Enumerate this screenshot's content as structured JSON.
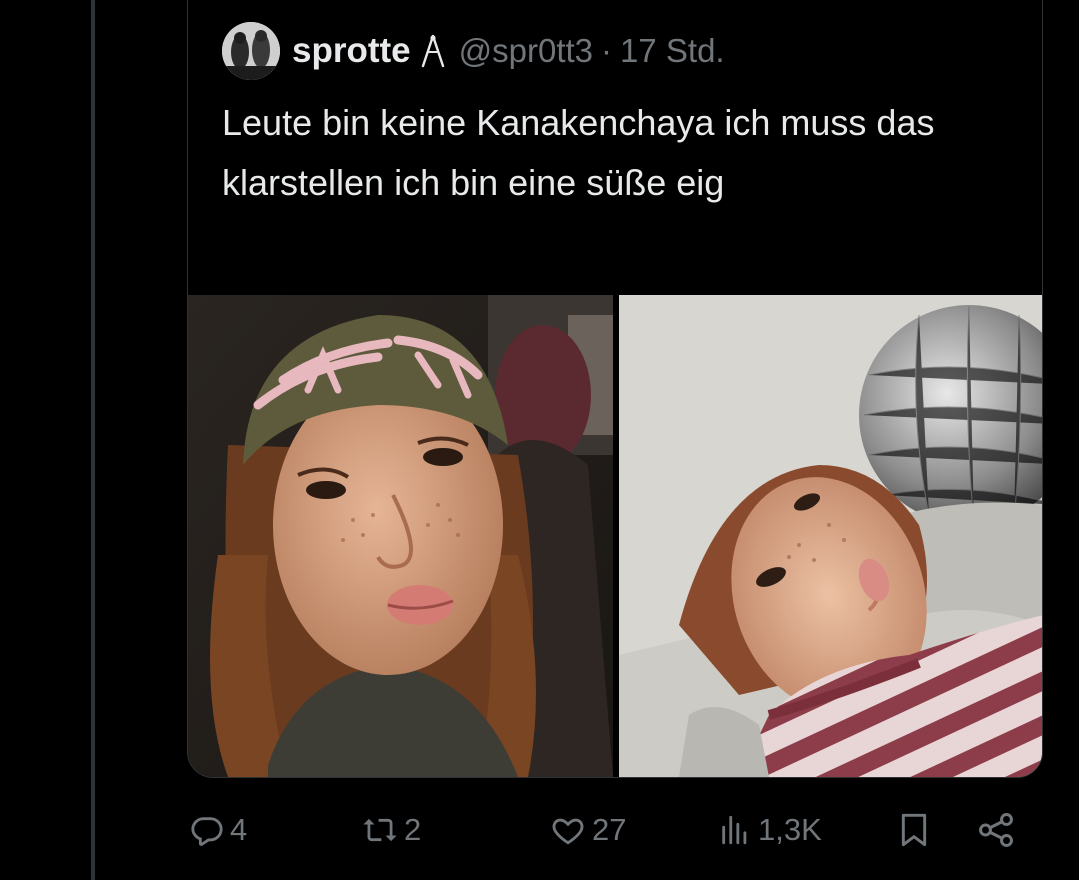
{
  "quoted_tweet": {
    "display_name": "sprotte",
    "badge_icon": "tweezers-emoji-icon",
    "handle": "@spr0tt3",
    "separator": "·",
    "time": "17 Std.",
    "text": "Leute bin keine Kanakenchaya ich muss das klarstellen ich bin eine süße eig",
    "media": [
      {
        "icon": "photo",
        "description": ""
      },
      {
        "icon": "photo",
        "description": ""
      }
    ]
  },
  "actions": {
    "reply": {
      "icon": "reply-icon",
      "count": "4"
    },
    "repost": {
      "icon": "repost-icon",
      "count": "2"
    },
    "like": {
      "icon": "heart-icon",
      "count": "27"
    },
    "views": {
      "icon": "views-icon",
      "count": "1,3K"
    },
    "bookmark": {
      "icon": "bookmark-icon"
    },
    "share": {
      "icon": "share-icon"
    }
  },
  "colors": {
    "background": "#000000",
    "text": "#e7e9ea",
    "secondary": "#71767b",
    "border": "#2f3336"
  }
}
